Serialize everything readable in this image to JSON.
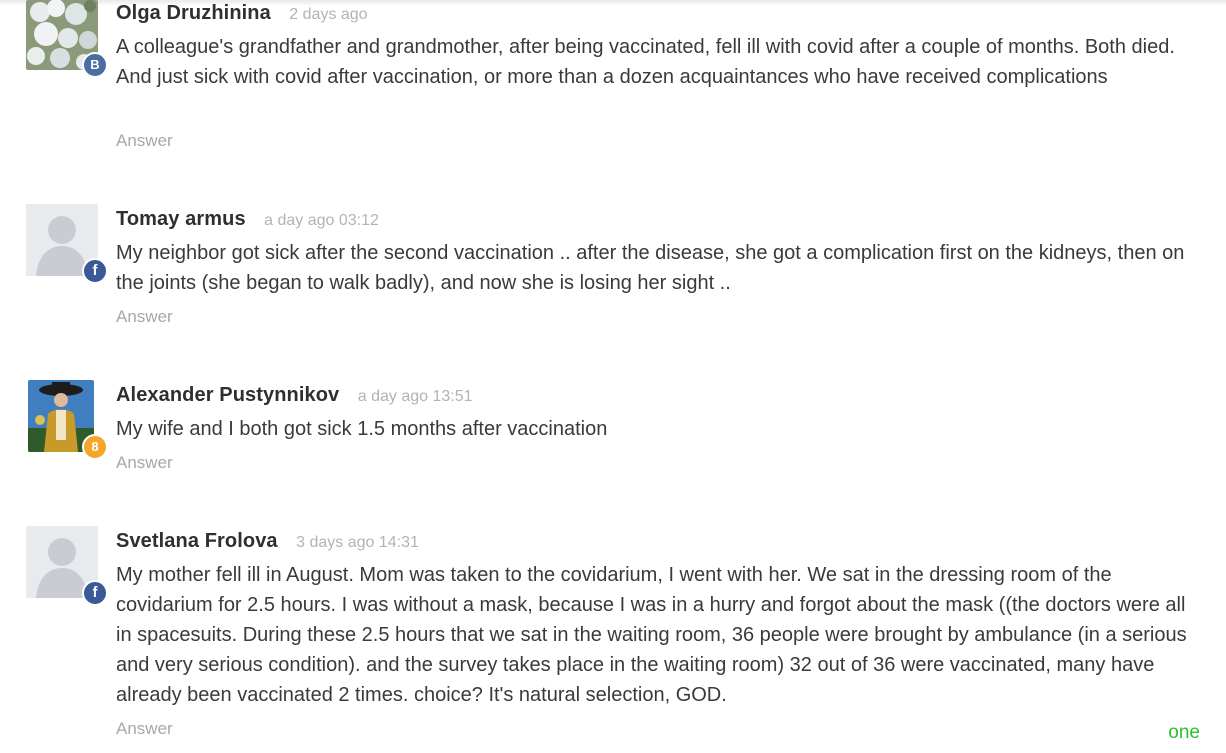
{
  "comments": [
    {
      "author": "Olga Druzhinina",
      "time": "2 days ago",
      "text": "A colleague's grandfather and grandmother, after being vaccinated, fell ill with covid after a couple of months. Both died. And just sick with covid after vaccination, or more than a dozen acquaintances who have received complications",
      "answer_label": "Answer",
      "badge": "B",
      "badge_icon": "vk-icon",
      "avatar": "flowers-photo"
    },
    {
      "author": "Tomay armus",
      "time": "a day ago 03:12",
      "text": "My neighbor got sick after the second vaccination .. after the disease, she got a complication first on the kidneys, then on the joints (she began to walk badly), and now she is losing her sight ..",
      "answer_label": "Answer",
      "badge": "f",
      "badge_icon": "facebook-icon",
      "avatar": "default-silhouette"
    },
    {
      "author": "Alexander Pustynnikov",
      "time": "a day ago 13:51",
      "text": "My wife and I both got sick 1.5 months after vaccination",
      "answer_label": "Answer",
      "badge": "8",
      "badge_icon": "odnoklassniki-icon",
      "avatar": "costume-photo"
    },
    {
      "author": "Svetlana Frolova",
      "time": "3 days ago 14:31",
      "text": "My mother fell ill in August. Mom was taken to the covidarium, I went with her. We sat in the dressing room of the covidarium for 2.5 hours. I was without a mask, because I was in a hurry and forgot about the mask ((the doctors were all in spacesuits. During these 2.5 hours that we sat in the waiting room, 36 people were brought by ambulance (in a serious and very serious condition). and the survey takes place in the waiting room) 32 out of 36 were vaccinated, many have already been vaccinated 2 times. choice? It's natural selection, GOD.",
      "answer_label": "Answer",
      "badge": "f",
      "badge_icon": "facebook-icon",
      "avatar": "default-silhouette"
    }
  ],
  "page_marker": "one",
  "colors": {
    "author": "#2f2f2f",
    "time": "#b3b3b3",
    "answer": "#a8a8a8",
    "page_marker": "#2bc02b",
    "vk": "#4a6ea1",
    "facebook": "#3b5998",
    "odnoklassniki": "#f4a62a"
  }
}
